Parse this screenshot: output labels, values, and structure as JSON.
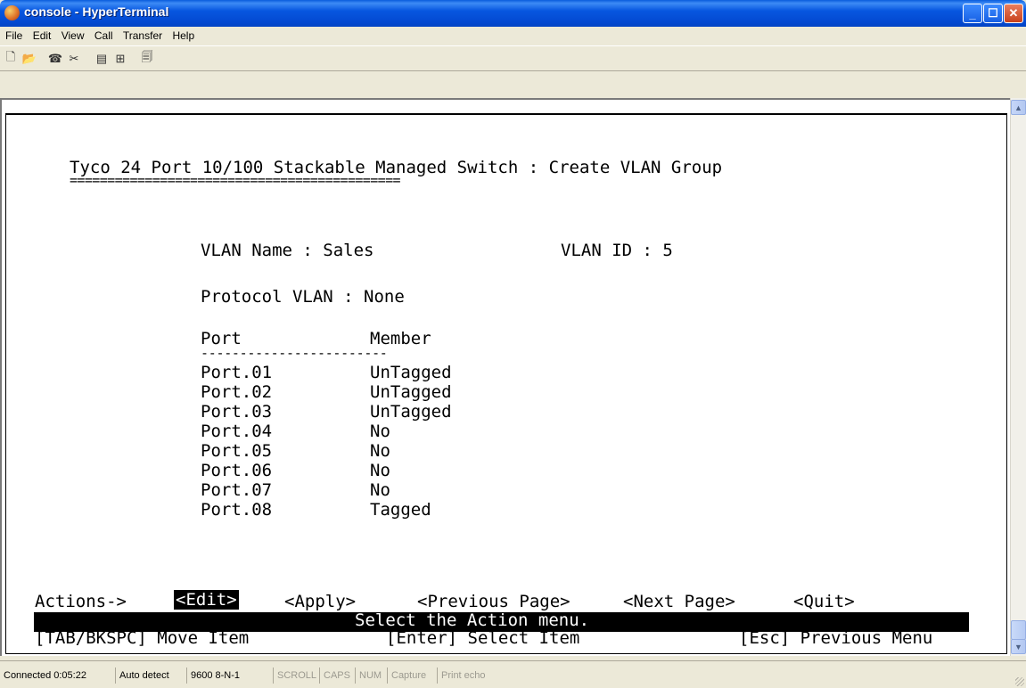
{
  "window": {
    "title": "console - HyperTerminal"
  },
  "menu": [
    "File",
    "Edit",
    "View",
    "Call",
    "Transfer",
    "Help"
  ],
  "toolbar": [
    {
      "name": "new-connection-icon",
      "glyph": "🗋"
    },
    {
      "name": "open-icon",
      "glyph": "📂"
    },
    {
      "name": "call-icon",
      "glyph": "☎"
    },
    {
      "name": "disconnect-icon",
      "glyph": "✂"
    },
    {
      "name": "send-icon",
      "glyph": "▤"
    },
    {
      "name": "receive-icon",
      "glyph": "⊞"
    },
    {
      "name": "properties-icon",
      "glyph": "🗐"
    }
  ],
  "terminal": {
    "heading": "Tyco 24 Port 10/100 Stackable Managed Switch : Create VLAN Group",
    "heading_rule": "============================================",
    "vlan_name_label": "VLAN Name : Sales",
    "vlan_id_label": "VLAN ID : 5",
    "protocol_vlan_label": "Protocol VLAN : None",
    "port_header": "Port",
    "member_header": "Member",
    "table_rule": "------------------------",
    "rows": [
      {
        "port": "Port.01",
        "member": "UnTagged"
      },
      {
        "port": "Port.02",
        "member": "UnTagged"
      },
      {
        "port": "Port.03",
        "member": "UnTagged"
      },
      {
        "port": "Port.04",
        "member": "No"
      },
      {
        "port": "Port.05",
        "member": "No"
      },
      {
        "port": "Port.06",
        "member": "No"
      },
      {
        "port": "Port.07",
        "member": "No"
      },
      {
        "port": "Port.08",
        "member": "Tagged"
      }
    ],
    "actions_label": "Actions->",
    "actions": {
      "edit": "<Edit>",
      "apply": "<Apply>",
      "previous": "<Previous Page>",
      "next": "<Next Page>",
      "quit": "<Quit>"
    },
    "status_message": "Select the Action menu.",
    "help_move": "[TAB/BKSPC] Move Item",
    "help_select": "[Enter] Select Item",
    "help_escape": "[Esc] Previous Menu"
  },
  "statusbar": {
    "connected": "Connected 0:05:22",
    "detect": "Auto detect",
    "settings": "9600 8-N-1",
    "scroll": "SCROLL",
    "caps": "CAPS",
    "num": "NUM",
    "capture": "Capture",
    "print_echo": "Print echo"
  }
}
